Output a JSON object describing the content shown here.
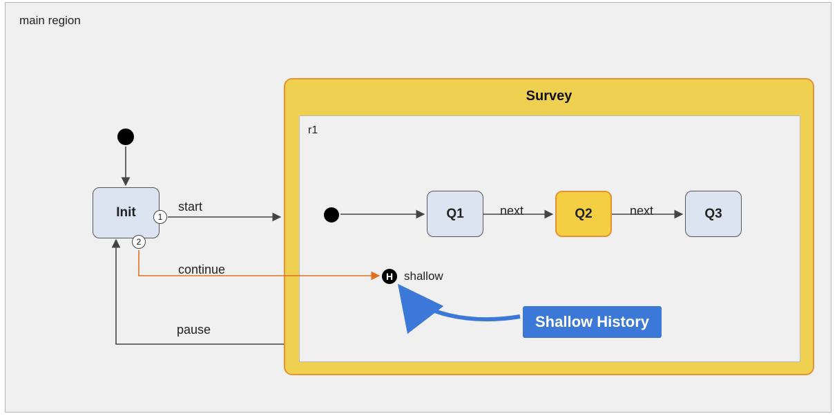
{
  "region": {
    "label": "main region",
    "inner_label": "r1"
  },
  "states": {
    "init": "Init",
    "survey": "Survey",
    "q1": "Q1",
    "q2": "Q2",
    "q3": "Q3"
  },
  "history": {
    "symbol": "H",
    "label": "shallow"
  },
  "ports": {
    "p1": "1",
    "p2": "2"
  },
  "transitions": {
    "start": "start",
    "continue": "continue",
    "pause": "pause",
    "next1": "next",
    "next2": "next"
  },
  "callout": {
    "text": "Shallow History"
  },
  "colors": {
    "region_bg": "#f0f0f0",
    "state_bg": "#dbe4f0",
    "composite_bg": "#f0d050",
    "composite_border": "#e69230",
    "highlight_state_bg": "#f5cf43",
    "callout_bg": "#3b78d8",
    "edge_default": "#444",
    "edge_highlight": "#e07020"
  },
  "diagram": {
    "type": "statechart",
    "initial": "Init",
    "composite": {
      "name": "Survey",
      "region": "r1",
      "initial": "Q1",
      "substates": [
        "Q1",
        "Q2",
        "Q3"
      ],
      "history": {
        "kind": "shallow",
        "last_active": "Q2"
      },
      "internal_transitions": [
        {
          "from": "Q1",
          "to": "Q2",
          "trigger": "next"
        },
        {
          "from": "Q2",
          "to": "Q3",
          "trigger": "next"
        }
      ]
    },
    "top_transitions": [
      {
        "from": "Init",
        "to": "Survey",
        "trigger": "start",
        "port": 1
      },
      {
        "from": "Init",
        "to": "Survey.history",
        "trigger": "continue",
        "port": 2
      },
      {
        "from": "Survey",
        "to": "Init",
        "trigger": "pause"
      }
    ]
  }
}
